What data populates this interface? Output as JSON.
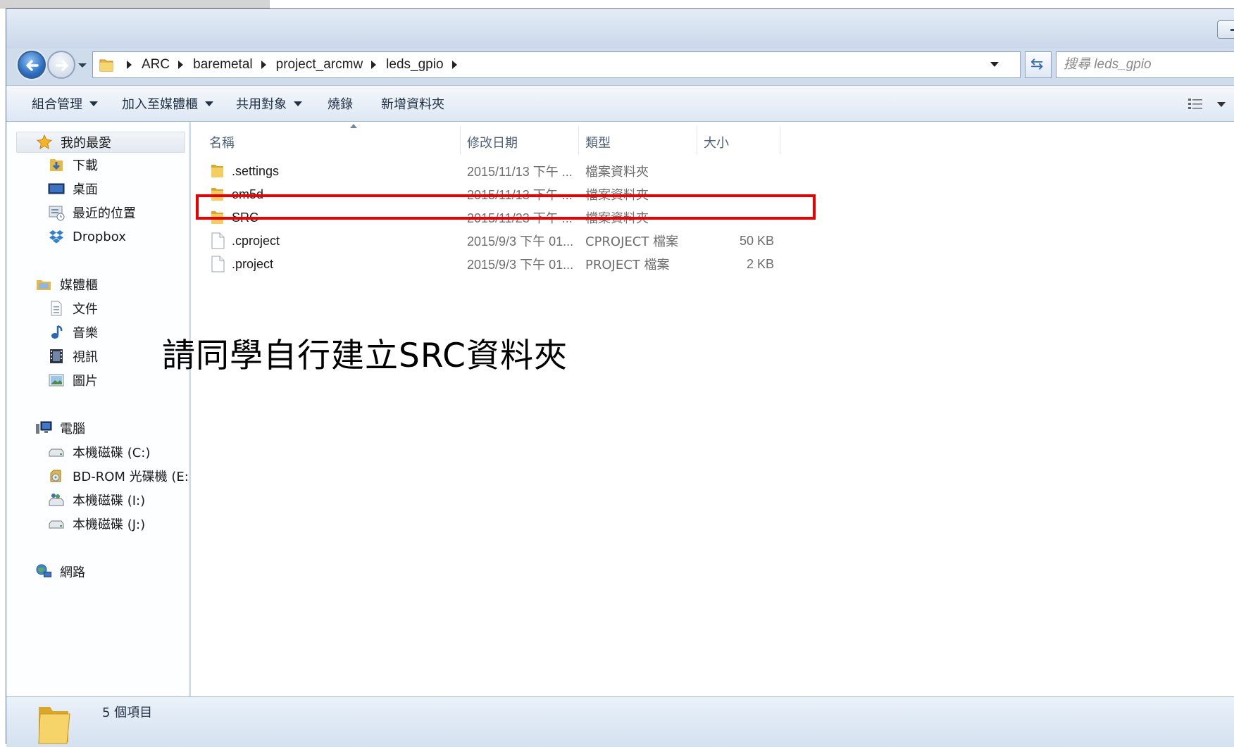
{
  "address": {
    "breadcrumbs": [
      "ARC",
      "baremetal",
      "project_arcmw",
      "leds_gpio"
    ]
  },
  "search": {
    "placeholder": "搜尋 leds_gpio"
  },
  "toolbar": {
    "organize": "組合管理",
    "add_to_library": "加入至媒體櫃",
    "share_with": "共用對象",
    "burn": "燒錄",
    "new_folder": "新增資料夾",
    "view_icon": "details-view-icon"
  },
  "sidebar": {
    "favorites": {
      "label": "我的最愛",
      "items": [
        {
          "label": "下載",
          "icon": "downloads-icon"
        },
        {
          "label": "桌面",
          "icon": "desktop-icon"
        },
        {
          "label": "最近的位置",
          "icon": "recent-places-icon"
        },
        {
          "label": "Dropbox",
          "icon": "dropbox-icon"
        }
      ]
    },
    "libraries": {
      "label": "媒體櫃",
      "items": [
        {
          "label": "文件",
          "icon": "documents-icon"
        },
        {
          "label": "音樂",
          "icon": "music-icon"
        },
        {
          "label": "視訊",
          "icon": "videos-icon"
        },
        {
          "label": "圖片",
          "icon": "pictures-icon"
        }
      ]
    },
    "computer": {
      "label": "電腦",
      "items": [
        {
          "label": "本機磁碟 (C:)",
          "icon": "drive-icon"
        },
        {
          "label": "BD-ROM 光碟機 (E:",
          "icon": "optical-drive-icon"
        },
        {
          "label": "本機磁碟 (I:)",
          "icon": "drive-icon"
        },
        {
          "label": "本機磁碟 (J:)",
          "icon": "drive-icon"
        }
      ]
    },
    "network": {
      "label": "網路"
    }
  },
  "columns": {
    "name": "名稱",
    "date": "修改日期",
    "type": "類型",
    "size": "大小"
  },
  "files": [
    {
      "name": ".settings",
      "date": "2015/11/13 下午 ...",
      "type": "檔案資料夾",
      "size": "",
      "kind": "folder"
    },
    {
      "name": "em5d",
      "date": "2015/11/13 下午 ...",
      "type": "檔案資料夾",
      "size": "",
      "kind": "folder"
    },
    {
      "name": "SRC",
      "date": "2015/11/23 下午 ...",
      "type": "檔案資料夾",
      "size": "",
      "kind": "folder"
    },
    {
      "name": ".cproject",
      "date": "2015/9/3 下午 01...",
      "type": "CPROJECT 檔案",
      "size": "50 KB",
      "kind": "file"
    },
    {
      "name": ".project",
      "date": "2015/9/3 下午 01...",
      "type": "PROJECT 檔案",
      "size": "2 KB",
      "kind": "file"
    }
  ],
  "annotation": "請同學自行建立SRC資料夾",
  "annotation_color": "#ea0000",
  "status": {
    "count": "5 個項目"
  }
}
